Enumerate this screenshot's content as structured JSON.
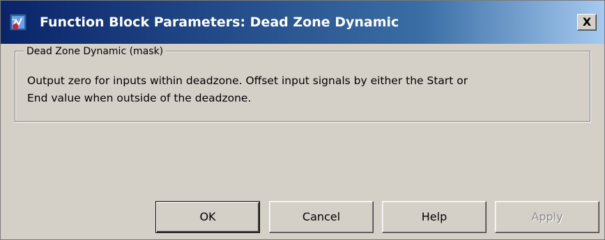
{
  "window": {
    "title": "Function Block Parameters: Dead Zone Dynamic",
    "close_label": "X"
  },
  "group": {
    "legend": "Dead Zone Dynamic (mask)",
    "description_line1": "Output zero for inputs within deadzone.  Offset input signals by either the Start or",
    "description_line2": "End value when outside of the deadzone."
  },
  "buttons": {
    "ok": "OK",
    "cancel": "Cancel",
    "help": "Help",
    "apply": "Apply"
  },
  "states": {
    "apply_enabled": false
  },
  "colors": {
    "dialog_background": "#d4d0c8",
    "titlebar_start": "#0a246a",
    "titlebar_end": "#a6caf0",
    "disabled_text": "#8a8a8a"
  },
  "icons": {
    "app": "simulink-block-icon",
    "close": "close-icon"
  }
}
